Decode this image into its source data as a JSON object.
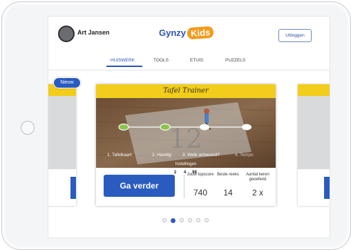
{
  "header": {
    "username": "Art Jansen",
    "logo_main": "Gynzy",
    "logo_kids": "Kids",
    "logout_label": "Uitloggen"
  },
  "tabs": [
    {
      "label": "HUISWERK",
      "active": true
    },
    {
      "label": "TOOLS",
      "active": false
    },
    {
      "label": "ETUIS",
      "active": false
    },
    {
      "label": "PUZZELS",
      "active": false
    }
  ],
  "carousel": {
    "new_badge": "Nieuw",
    "card": {
      "title": "Tafel Trainer",
      "steps": [
        {
          "label": "1. Tafelkaart",
          "state": "done"
        },
        {
          "label": "2. Handig",
          "state": "done"
        },
        {
          "label": "3. Welk antwoord?",
          "state": "current"
        },
        {
          "label": "4. Tempo",
          "state": "todo"
        }
      ],
      "settings_label": "Instellingen",
      "settings_values": [
        "2",
        "4",
        "98"
      ],
      "go_button": "Ga verder",
      "stats": [
        {
          "label": "Jouw topscore",
          "value": "740"
        },
        {
          "label": "Beste reeks",
          "value": "14"
        },
        {
          "label": "Aantal keren geoefend",
          "value": "2 x"
        }
      ]
    },
    "page_count": 6,
    "active_page": 2
  },
  "colors": {
    "accent": "#2a5bbf",
    "title_band": "#f2cd1b",
    "step_done": "#8bc34a",
    "logo_badge": "#f39a1a"
  }
}
